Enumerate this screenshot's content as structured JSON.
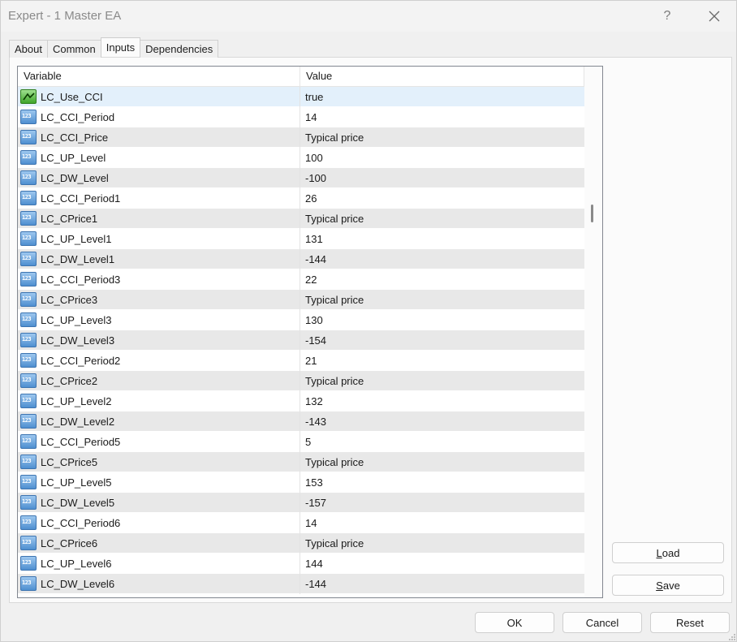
{
  "window": {
    "title": "Expert - 1 Master EA",
    "help_glyph": "?"
  },
  "tabs": [
    {
      "label": "About"
    },
    {
      "label": "Common"
    },
    {
      "label": "Inputs"
    },
    {
      "label": "Dependencies"
    }
  ],
  "active_tab": "Inputs",
  "grid": {
    "columns": {
      "variable": "Variable",
      "value": "Value"
    },
    "rows": [
      {
        "variable": "LC_Use_CCI",
        "value": "true",
        "icon": "bool-icon"
      },
      {
        "variable": "LC_CCI_Period",
        "value": "14",
        "icon": "numeric-icon"
      },
      {
        "variable": "LC_CCI_Price",
        "value": "Typical price",
        "icon": "numeric-icon"
      },
      {
        "variable": "LC_UP_Level",
        "value": "100",
        "icon": "numeric-icon"
      },
      {
        "variable": "LC_DW_Level",
        "value": "-100",
        "icon": "numeric-icon"
      },
      {
        "variable": "LC_CCI_Period1",
        "value": "26",
        "icon": "numeric-icon"
      },
      {
        "variable": "LC_CPrice1",
        "value": "Typical price",
        "icon": "numeric-icon"
      },
      {
        "variable": "LC_UP_Level1",
        "value": "131",
        "icon": "numeric-icon"
      },
      {
        "variable": "LC_DW_Level1",
        "value": "-144",
        "icon": "numeric-icon"
      },
      {
        "variable": "LC_CCI_Period3",
        "value": "22",
        "icon": "numeric-icon"
      },
      {
        "variable": "LC_CPrice3",
        "value": "Typical price",
        "icon": "numeric-icon"
      },
      {
        "variable": "LC_UP_Level3",
        "value": "130",
        "icon": "numeric-icon"
      },
      {
        "variable": "LC_DW_Level3",
        "value": "-154",
        "icon": "numeric-icon"
      },
      {
        "variable": "LC_CCI_Period2",
        "value": "21",
        "icon": "numeric-icon"
      },
      {
        "variable": "LC_CPrice2",
        "value": "Typical price",
        "icon": "numeric-icon"
      },
      {
        "variable": "LC_UP_Level2",
        "value": "132",
        "icon": "numeric-icon"
      },
      {
        "variable": "LC_DW_Level2",
        "value": "-143",
        "icon": "numeric-icon"
      },
      {
        "variable": "LC_CCI_Period5",
        "value": "5",
        "icon": "numeric-icon"
      },
      {
        "variable": "LC_CPrice5",
        "value": "Typical price",
        "icon": "numeric-icon"
      },
      {
        "variable": "LC_UP_Level5",
        "value": "153",
        "icon": "numeric-icon"
      },
      {
        "variable": "LC_DW_Level5",
        "value": "-157",
        "icon": "numeric-icon"
      },
      {
        "variable": "LC_CCI_Period6",
        "value": "14",
        "icon": "numeric-icon"
      },
      {
        "variable": "LC_CPrice6",
        "value": "Typical price",
        "icon": "numeric-icon"
      },
      {
        "variable": "LC_UP_Level6",
        "value": "144",
        "icon": "numeric-icon"
      },
      {
        "variable": "LC_DW_Level6",
        "value": "-144",
        "icon": "numeric-icon"
      }
    ]
  },
  "side_buttons": {
    "load": "Load",
    "save": "Save"
  },
  "footer_buttons": {
    "ok": "OK",
    "cancel": "Cancel",
    "reset": "Reset"
  },
  "colors": {
    "selected_row": "#e3f0fb",
    "alt_row": "#e8e8e8"
  }
}
